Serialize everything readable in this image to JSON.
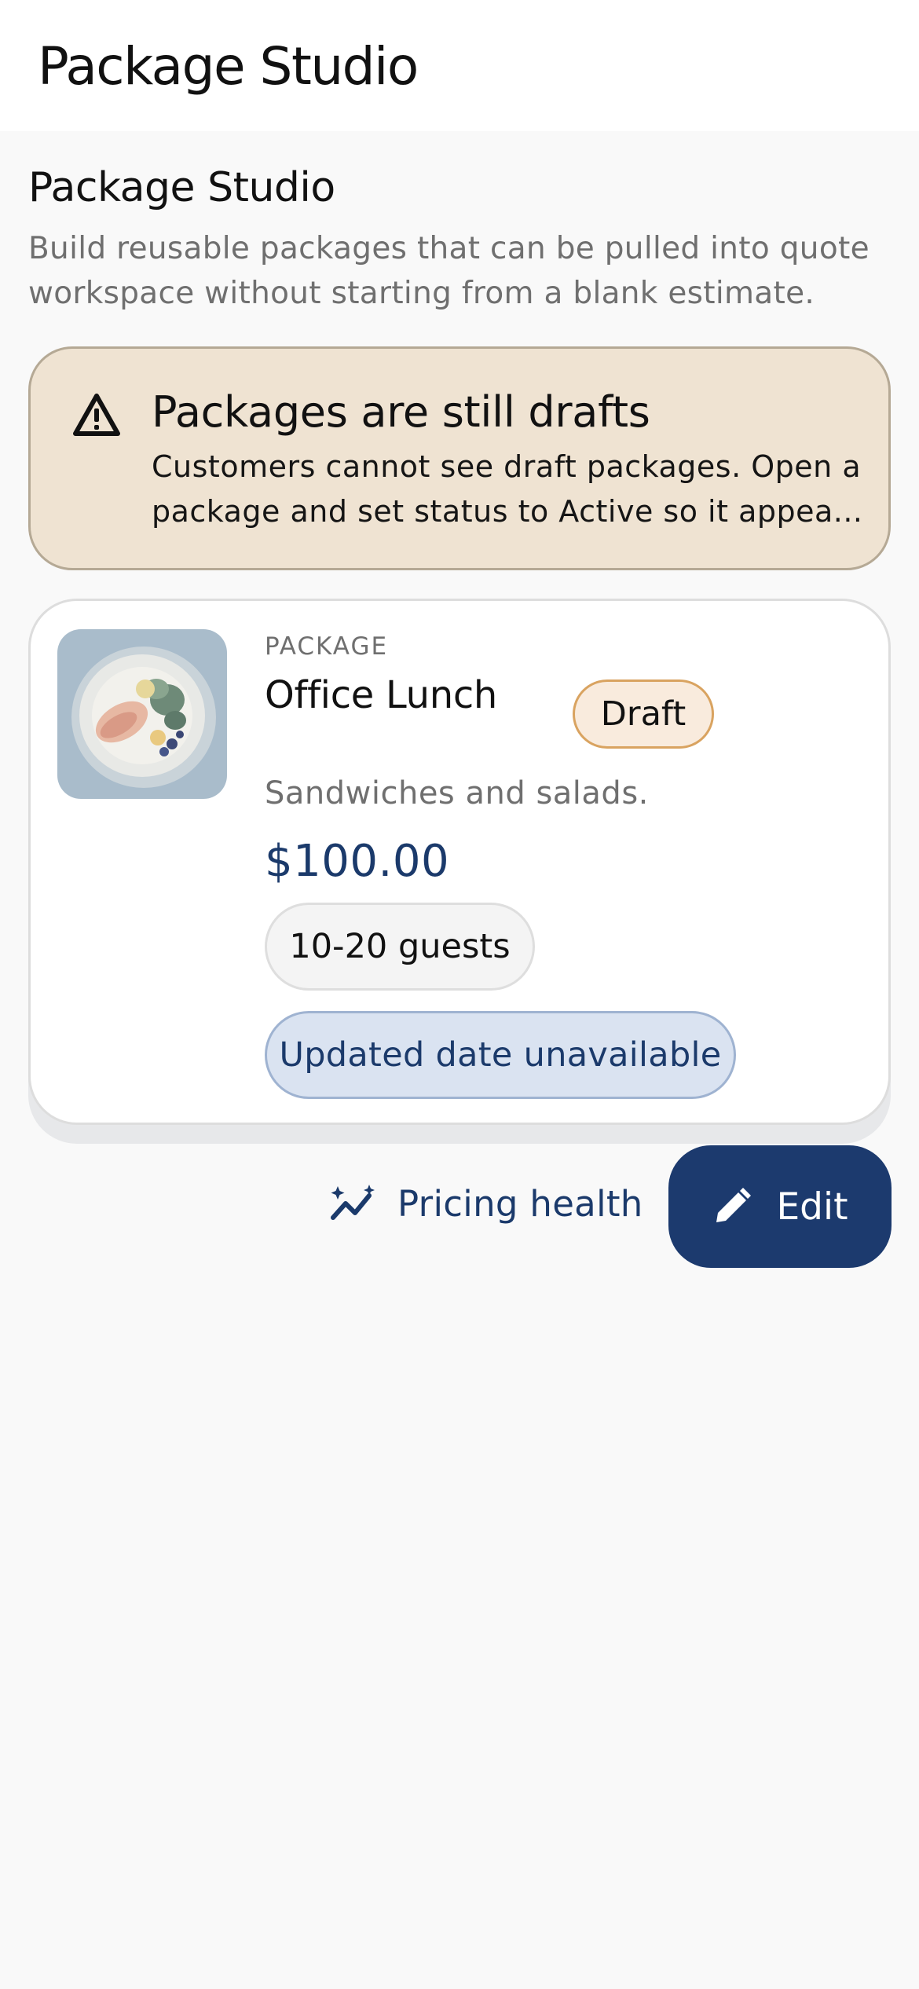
{
  "app_bar": {
    "title": "Package Studio"
  },
  "section": {
    "title": "Package Studio",
    "description": "Build reusable packages that can be pulled into quote workspace without starting from a blank estimate."
  },
  "banner": {
    "icon": "warning-triangle-icon",
    "title": "Packages are still drafts",
    "text_line1": "Customers cannot see draft packages. Open a",
    "text_line2": "package and set status to Active so it appea..."
  },
  "package_card": {
    "eyebrow": "PACKAGE",
    "name": "Office Lunch",
    "status": "Draft",
    "description": "Sandwiches and salads.",
    "price": "$100.00",
    "guests": "10-20 guests",
    "updated": "Updated date unavailable"
  },
  "actions": {
    "pricing_health_label": "Pricing health",
    "pricing_health_icon": "sparkle-trend-icon",
    "edit_label": "Edit",
    "edit_icon": "pencil-icon"
  },
  "colors": {
    "accent": "#1c3a6e",
    "banner_bg": "#efe3d2",
    "draft_badge_border": "#d9a360",
    "updated_chip_bg": "#dae3f1"
  }
}
